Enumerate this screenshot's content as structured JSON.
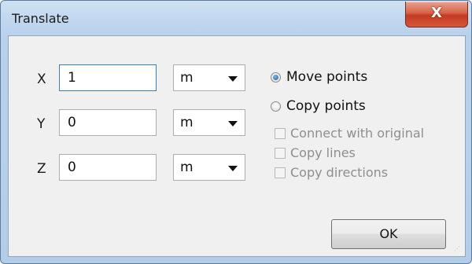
{
  "window": {
    "title": "Translate",
    "close_label": "X"
  },
  "fields": [
    {
      "axis": "X",
      "value": "1",
      "unit": "m"
    },
    {
      "axis": "Y",
      "value": "0",
      "unit": "m"
    },
    {
      "axis": "Z",
      "value": "0",
      "unit": "m"
    }
  ],
  "mode": {
    "move_label": "Move points",
    "copy_label": "Copy points",
    "selected": "move"
  },
  "copy_options": [
    {
      "label": "Connect with original",
      "checked": false,
      "enabled": false
    },
    {
      "label": "Copy lines",
      "checked": false,
      "enabled": false
    },
    {
      "label": "Copy directions",
      "checked": false,
      "enabled": false
    }
  ],
  "ok_label": "OK",
  "colors": {
    "accent": "#1d5fa3",
    "close": "#c43b22"
  }
}
